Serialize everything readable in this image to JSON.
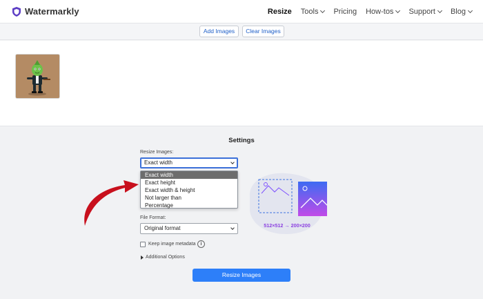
{
  "header": {
    "brand": "Watermarkly",
    "nav": [
      {
        "label": "Resize",
        "active": true,
        "dropdown": false
      },
      {
        "label": "Tools",
        "active": false,
        "dropdown": true
      },
      {
        "label": "Pricing",
        "active": false,
        "dropdown": false
      },
      {
        "label": "How-tos",
        "active": false,
        "dropdown": true
      },
      {
        "label": "Support",
        "active": false,
        "dropdown": true
      },
      {
        "label": "Blog",
        "active": false,
        "dropdown": true
      }
    ]
  },
  "toolbar": {
    "add_label": "Add Images",
    "clear_label": "Clear Images"
  },
  "settings": {
    "title": "Settings",
    "resize_label": "Resize Images:",
    "resize_value": "Exact width",
    "resize_options": [
      "Exact width",
      "Exact height",
      "Exact width & height",
      "Not larger than",
      "Percentage"
    ],
    "format_label": "File Format:",
    "format_value": "Original format",
    "metadata_label": "Keep image metadata",
    "metadata_checked": false,
    "additional_label": "Additional Options",
    "resize_button": "Resize Images",
    "dimension_caption": "512×512 → 200×200"
  },
  "colors": {
    "accent": "#2d7ff9",
    "illustration_purple": "#7c4dff",
    "arrow_red": "#c8101d"
  }
}
